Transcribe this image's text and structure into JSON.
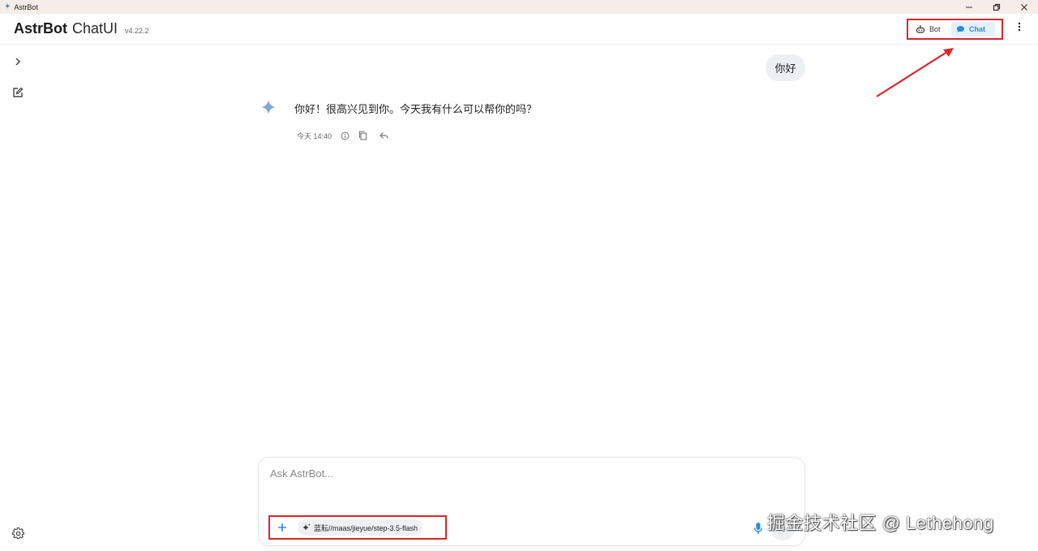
{
  "window": {
    "title": "AstrBot",
    "controls": {
      "minimize": "—",
      "restore": "❐",
      "close": "✕"
    }
  },
  "header": {
    "brand_bold": "AstrBot",
    "brand_light": "ChatUI",
    "version": "v4.22.2",
    "mode_switch": {
      "bot_label": "Bot",
      "chat_label": "Chat",
      "active": "Chat"
    },
    "menu_icon": "more-vertical-icon"
  },
  "sidebar": {
    "toggle_icon": "chevron-right-icon",
    "new_chat_icon": "edit-icon",
    "settings_icon": "gear-icon"
  },
  "conversation": {
    "user_message": "你好",
    "bot_message": "你好！很高兴见到你。今天我有什么可以帮你的吗？",
    "bot_time": "今天 14:40"
  },
  "composer": {
    "placeholder": "Ask AstrBot...",
    "value": "",
    "model_label": "蓝耘//maas/jieyue/step-3.5-flash"
  },
  "watermark": "掘金技术社区 @ Lethehong",
  "colors": {
    "accent": "#2d8bd6",
    "highlight_border": "#d9262c",
    "arrow": "#d9262c"
  }
}
